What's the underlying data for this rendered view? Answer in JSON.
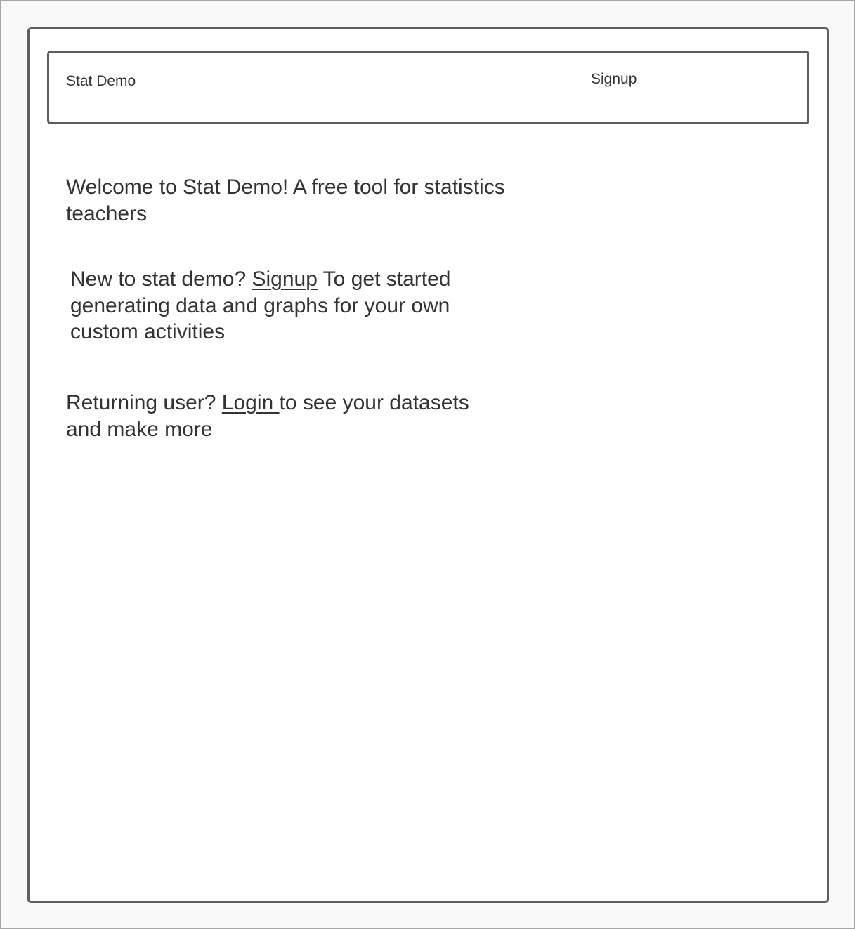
{
  "header": {
    "brand": "Stat Demo",
    "signup_label": "Signup"
  },
  "main": {
    "welcome_text": "Welcome to Stat Demo! A free tool for statistics teachers",
    "new_user": {
      "prefix": "New to stat demo? ",
      "link_label": "Signup",
      "suffix": " To get started generating data and graphs  for your own custom activities"
    },
    "returning_user": {
      "prefix": "Returning user? ",
      "link_label": "Login ",
      "suffix": "to see your datasets and make more"
    }
  },
  "colors": {
    "border": "#5e5e5e",
    "text": "#333333",
    "background": "#f9f9f9",
    "panel": "#ffffff"
  }
}
